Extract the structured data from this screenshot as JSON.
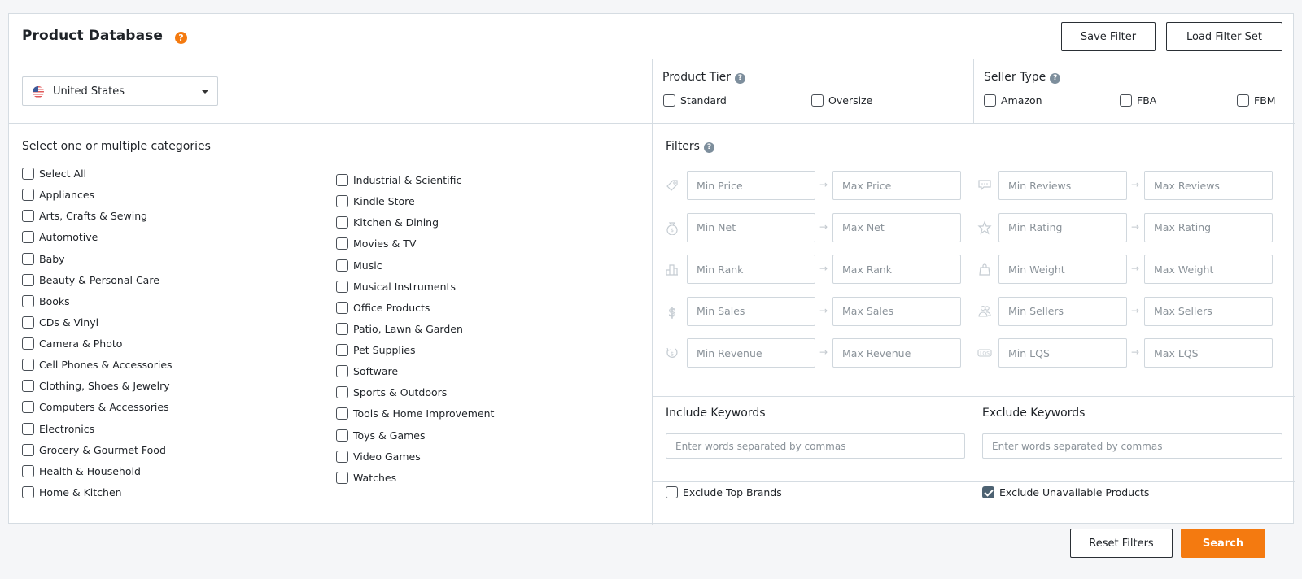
{
  "header": {
    "title": "Product Database",
    "help_icon": "question-circle-icon",
    "save_filter_label": "Save Filter",
    "load_filter_set_label": "Load Filter Set"
  },
  "country": {
    "selected": "United States",
    "flag_icon": "us-flag-icon"
  },
  "product_tier": {
    "label": "Product Tier",
    "options": [
      {
        "label": "Standard",
        "checked": false
      },
      {
        "label": "Oversize",
        "checked": false
      }
    ]
  },
  "seller_type": {
    "label": "Seller Type",
    "options": [
      {
        "label": "Amazon",
        "checked": false
      },
      {
        "label": "FBA",
        "checked": false
      },
      {
        "label": "FBM",
        "checked": false
      }
    ]
  },
  "categories": {
    "label": "Select one or multiple categories",
    "column1": [
      "Select All",
      "Appliances",
      "Arts, Crafts & Sewing",
      "Automotive",
      "Baby",
      "Beauty & Personal Care",
      "Books",
      "CDs & Vinyl",
      "Camera & Photo",
      "Cell Phones & Accessories",
      "Clothing, Shoes & Jewelry",
      "Computers & Accessories",
      "Electronics",
      "Grocery & Gourmet Food",
      "Health & Household",
      "Home & Kitchen"
    ],
    "column2": [
      "Industrial & Scientific",
      "Kindle Store",
      "Kitchen & Dining",
      "Movies & TV",
      "Music",
      "Musical Instruments",
      "Office Products",
      "Patio, Lawn & Garden",
      "Pet Supplies",
      "Software",
      "Sports & Outdoors",
      "Tools & Home Improvement",
      "Toys & Games",
      "Video Games",
      "Watches"
    ]
  },
  "filters": {
    "label": "Filters",
    "left": [
      {
        "icon": "price-tag-icon",
        "min": "Min Price",
        "max": "Max Price"
      },
      {
        "icon": "money-bag-icon",
        "min": "Min Net",
        "max": "Max Net"
      },
      {
        "icon": "bar-chart-icon",
        "min": "Min Rank",
        "max": "Max Rank"
      },
      {
        "icon": "dollar-icon",
        "min": "Min Sales",
        "max": "Max Sales"
      },
      {
        "icon": "revenue-cycle-icon",
        "min": "Min Revenue",
        "max": "Max Revenue"
      }
    ],
    "right": [
      {
        "icon": "chat-bubble-icon",
        "min": "Min Reviews",
        "max": "Max Reviews"
      },
      {
        "icon": "star-icon",
        "min": "Min Rating",
        "max": "Max Rating"
      },
      {
        "icon": "weight-bag-icon",
        "min": "Min Weight",
        "max": "Max Weight"
      },
      {
        "icon": "users-icon",
        "min": "Min Sellers",
        "max": "Max Sellers"
      },
      {
        "icon": "lqs-icon",
        "min": "Min LQS",
        "max": "Max LQS"
      }
    ]
  },
  "keywords": {
    "include_label": "Include Keywords",
    "include_placeholder": "Enter words separated by commas",
    "exclude_label": "Exclude Keywords",
    "exclude_placeholder": "Enter words separated by commas"
  },
  "exclusions": {
    "top_brands": {
      "label": "Exclude Top Brands",
      "checked": false
    },
    "unavailable": {
      "label": "Exclude Unavailable Products",
      "checked": true
    }
  },
  "footer": {
    "reset_label": "Reset Filters",
    "search_label": "Search"
  },
  "colors": {
    "accent": "#f47a10",
    "checked": "#4d6272",
    "border": "#d5dce2"
  }
}
